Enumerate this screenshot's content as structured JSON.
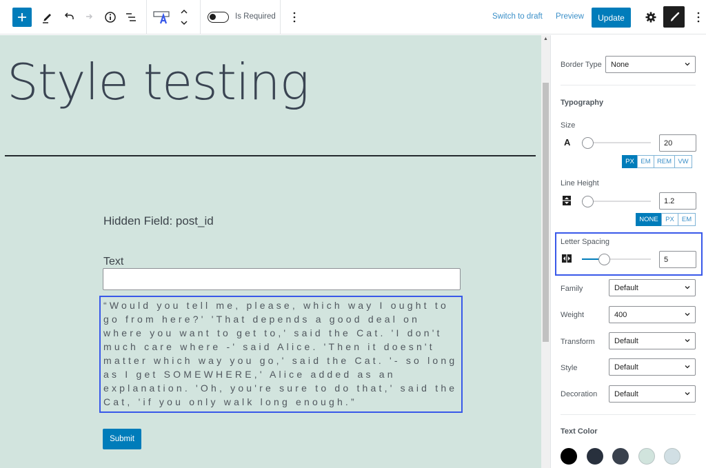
{
  "toolbar": {
    "add_block_icon": "plus-icon",
    "tools_icon": "pencil-icon",
    "undo_icon": "undo-icon",
    "redo_icon": "redo-icon",
    "info_icon": "info-icon",
    "list_view_icon": "list-view-icon",
    "block_type_icon": "text-field-icon",
    "move_icon": "chevron-up-down-icon",
    "is_required_label": "Is Required",
    "is_required_checked": false,
    "more_options_icon": "kebab-menu-icon",
    "switch_to_draft_label": "Switch to draft",
    "preview_label": "Preview",
    "update_label": "Update",
    "settings_icon": "gear-icon",
    "styles_icon": "brush-icon",
    "more_menu_icon": "kebab-menu-icon"
  },
  "canvas": {
    "post_title": "Style testing",
    "hidden_field_label": "Hidden Field: post_id",
    "text_field_label": "Text",
    "text_field_value": "",
    "quote_text": "“Would you tell me, please, which way I ought to go from here?' 'That depends a good deal on where you want to get to,' said the Cat. 'I don't much care where -' said Alice. 'Then it doesn't matter which way you go,' said the Cat. '- so long as I get SOMEWHERE,' Alice added as an explanation. 'Oh, you're sure to do that,' said the Cat, 'if you only walk long enough.”",
    "submit_label": "Submit"
  },
  "sidebar": {
    "border_type": {
      "label": "Border Type",
      "value": "None"
    },
    "typography_heading": "Typography",
    "size": {
      "label": "Size",
      "icon": "font-size-icon",
      "value": "20",
      "slider_fraction": 0.0,
      "units": [
        "PX",
        "EM",
        "REM",
        "VW"
      ],
      "active_unit": "PX"
    },
    "line_height": {
      "label": "Line Height",
      "icon": "line-height-icon",
      "value": "1.2",
      "slider_fraction": 0.0,
      "units": [
        "NONE",
        "PX",
        "EM"
      ],
      "active_unit": "NONE"
    },
    "letter_spacing": {
      "label": "Letter Spacing",
      "icon": "letter-spacing-icon",
      "value": "5",
      "slider_fraction": 0.32
    },
    "family": {
      "label": "Family",
      "value": "Default"
    },
    "weight": {
      "label": "Weight",
      "value": "400"
    },
    "transform": {
      "label": "Transform",
      "value": "Default"
    },
    "style": {
      "label": "Style",
      "value": "Default"
    },
    "decoration": {
      "label": "Decoration",
      "value": "Default"
    },
    "text_color": {
      "heading": "Text Color",
      "swatches": [
        "#000000",
        "#28303d",
        "#39414d",
        "#d1e4dd",
        "#d1dfe4"
      ]
    }
  },
  "colors": {
    "accent": "#007cba",
    "canvas_bg": "#d2e4de",
    "selection_outline": "#3858e9"
  }
}
